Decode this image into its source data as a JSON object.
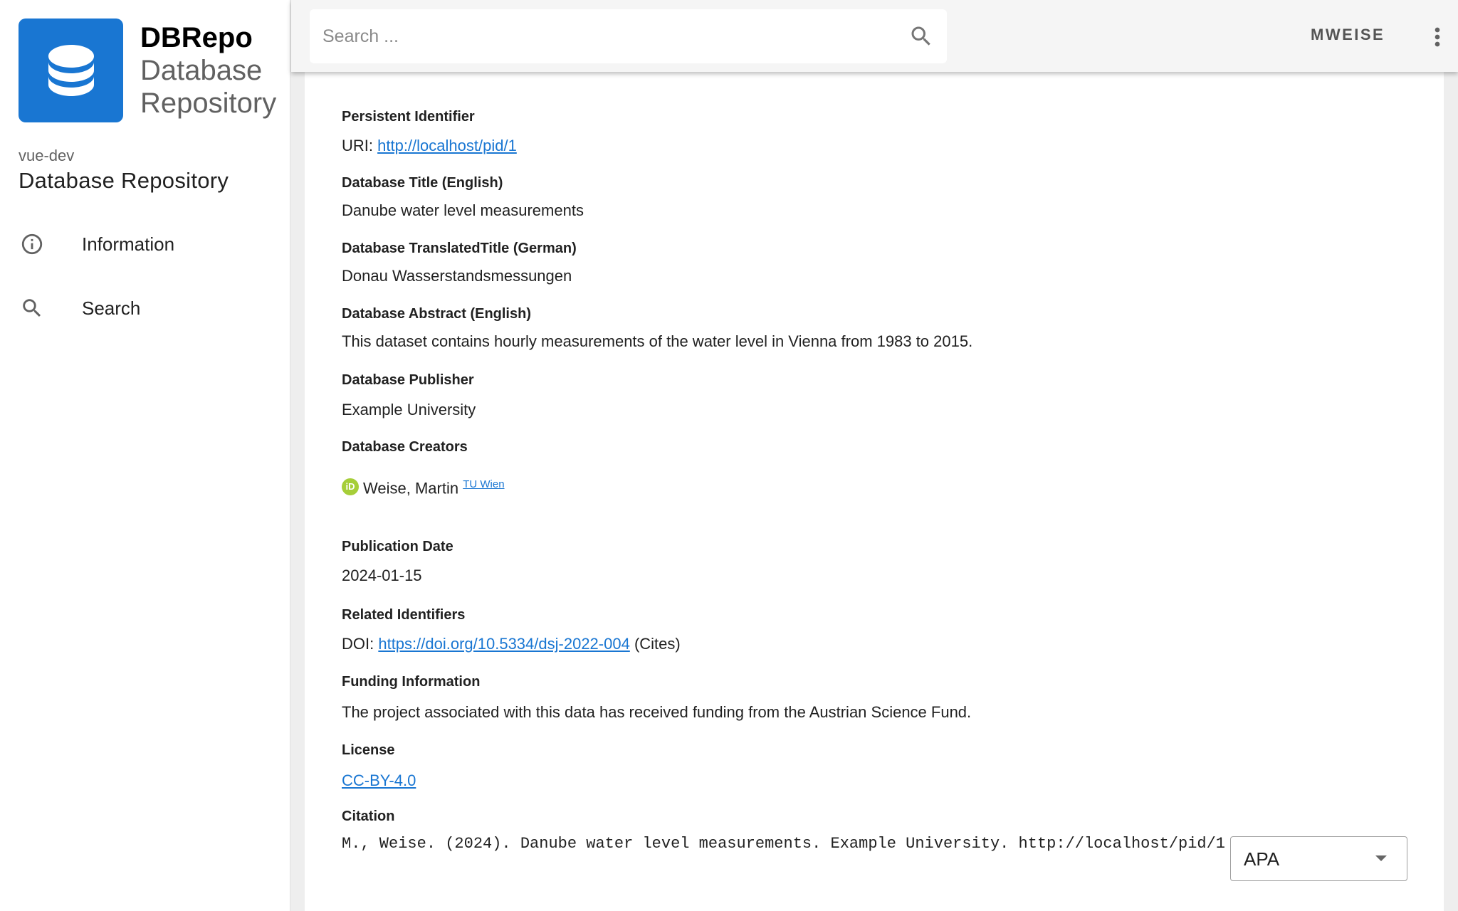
{
  "brand": {
    "name": "DBRepo",
    "subtitle_line1": "Database",
    "subtitle_line2": "Repository"
  },
  "sidebar": {
    "environment": "vue-dev",
    "title": "Database Repository",
    "items": [
      {
        "label": "Information",
        "icon": "info-icon"
      },
      {
        "label": "Search",
        "icon": "search-icon"
      }
    ]
  },
  "topbar": {
    "search_placeholder": "Search ...",
    "user": "MWEISE",
    "menu_icon": "more-vert-icon"
  },
  "metadata": {
    "pid": {
      "label": "Persistent Identifier",
      "prefix": "URI: ",
      "link": "http://localhost/pid/1"
    },
    "title": {
      "label": "Database Title (English)",
      "value": "Danube water level measurements"
    },
    "translated_title": {
      "label": "Database TranslatedTitle (German)",
      "value": "Donau Wasserstandsmessungen"
    },
    "abstract": {
      "label": "Database Abstract (English)",
      "value": "This dataset contains hourly measurements of the water level in Vienna from 1983 to 2015."
    },
    "publisher": {
      "label": "Database Publisher",
      "value": "Example University"
    },
    "creators": {
      "label": "Database Creators",
      "orcid_badge": "iD",
      "name": "Weise, Martin",
      "affiliation": "TU Wien"
    },
    "publication_date": {
      "label": "Publication Date",
      "value": "2024-01-15"
    },
    "related": {
      "label": "Related Identifiers",
      "prefix": "DOI: ",
      "link": "https://doi.org/10.5334/dsj-2022-004",
      "relation": "(Cites)"
    },
    "funding": {
      "label": "Funding Information",
      "value": "The project associated with this data has received funding from the Austrian Science Fund."
    },
    "license": {
      "label": "License",
      "link": "CC-BY-4.0"
    },
    "citation": {
      "label": "Citation",
      "value": "M., Weise. (2024). Danube water level measurements. Example University. http://localhost/pid/1",
      "style": "APA"
    }
  },
  "colors": {
    "primary": "#1976d2",
    "orcid": "#a6ce39"
  }
}
